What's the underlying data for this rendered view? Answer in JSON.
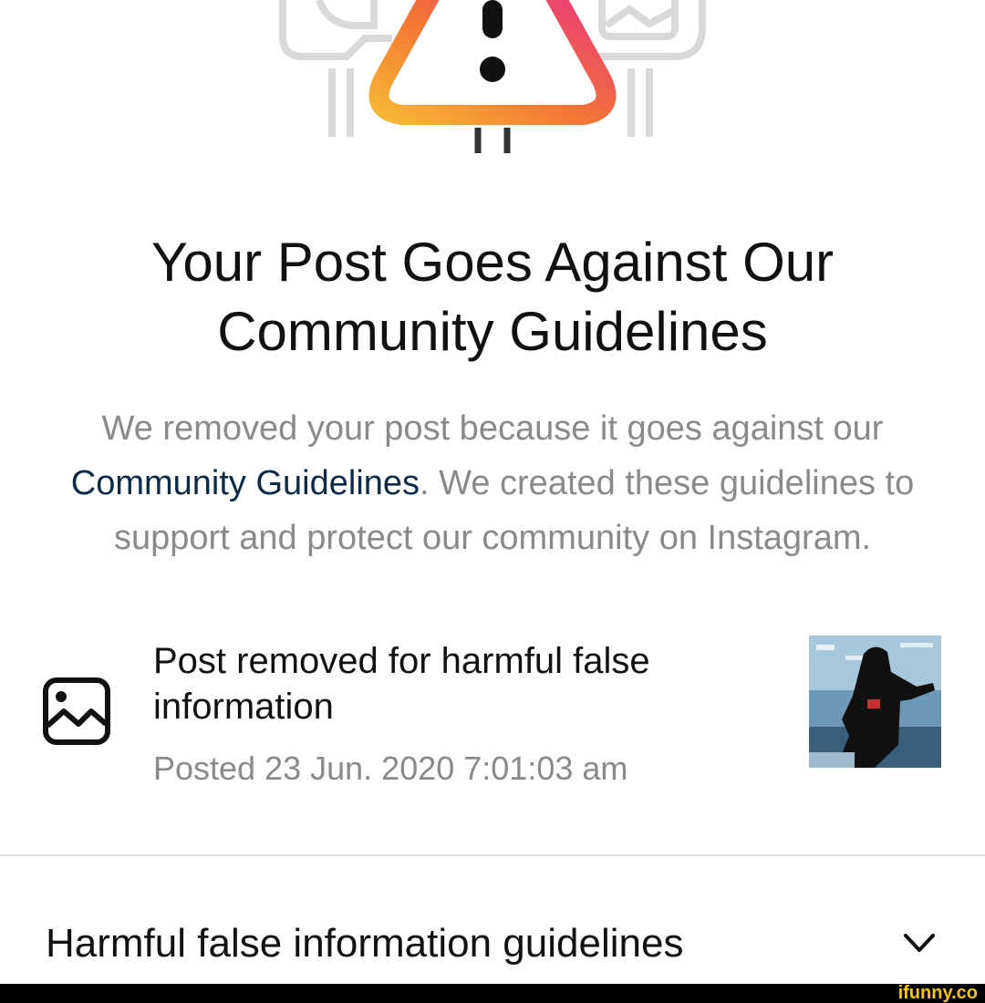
{
  "dialog": {
    "title_line1": "Your Post Goes Against Our",
    "title_line2": "Community Guidelines",
    "body_prefix": "We removed your post because it goes against our ",
    "body_link": "Community Guidelines",
    "body_suffix": ". We created these guidelines to support and protect our community on Instagram."
  },
  "post": {
    "status": "Post removed for harmful false information",
    "posted": "Posted 23 Jun. 2020 7:01:03 am",
    "icon": "image-icon"
  },
  "section": {
    "label": "Harmful false information guidelines",
    "icon": "chevron-down-icon"
  },
  "watermark": "ifunny.co",
  "colors": {
    "link": "#0d2a47",
    "muted": "#8a8a8a",
    "warning_gradient": [
      "#f7b733",
      "#f37335",
      "#e8308a"
    ]
  }
}
